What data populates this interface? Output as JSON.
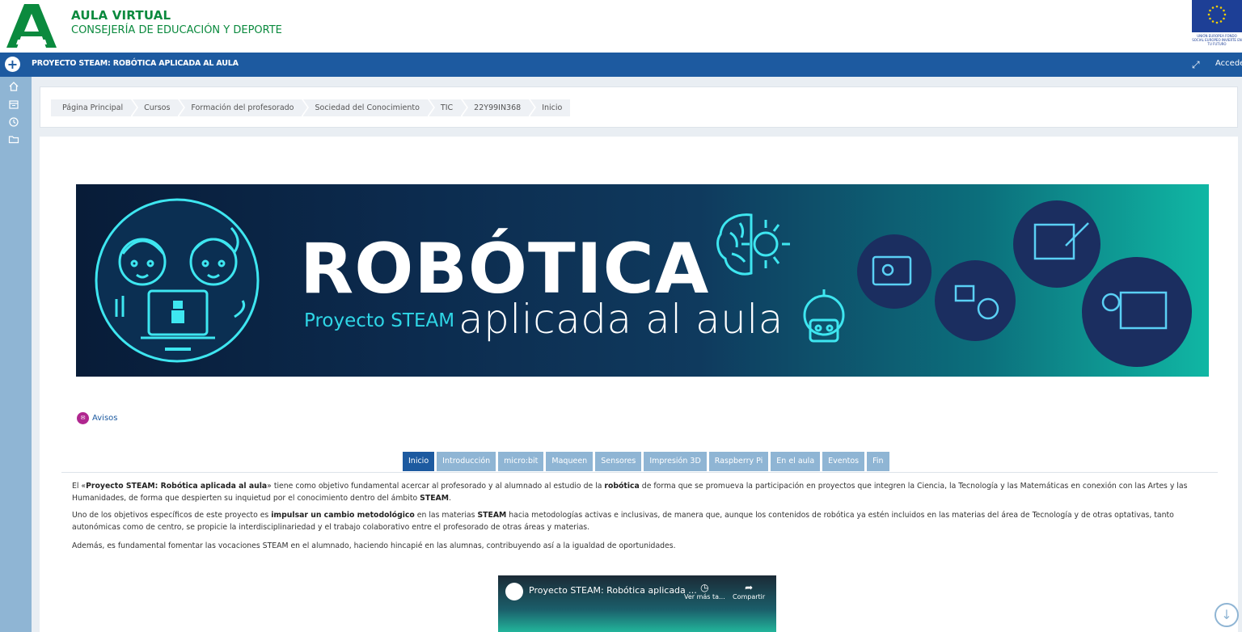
{
  "header": {
    "title": "AULA VIRTUAL",
    "subtitle": "CONSEJERÍA DE EDUCACIÓN Y DEPORTE",
    "eu_text": "UNIÓN EUROPEA FONDO SOCIAL EUROPEO INVIERTE EN TU FUTURO"
  },
  "course_bar": {
    "title": "PROYECTO STEAM: ROBÓTICA APLICADA AL AULA",
    "access_label": "Acceder",
    "colors": {
      "bar": "#1d5aa0"
    }
  },
  "sidebar": {
    "icons": [
      "home-icon",
      "calendar-icon",
      "clock-icon",
      "folder-icon"
    ]
  },
  "breadcrumb": [
    "Página Principal",
    "Cursos",
    "Formación del profesorado",
    "Sociedad del Conocimiento",
    "TIC",
    "22Y99IN368",
    "Inicio"
  ],
  "banner": {
    "title": "ROBÓTICA",
    "subtitle_small": "Proyecto STEAM",
    "subtitle_large": "aplicada al aula"
  },
  "avisos": {
    "label": "Avisos"
  },
  "tabs": [
    {
      "label": "Inicio",
      "active": true
    },
    {
      "label": "Introducción",
      "active": false
    },
    {
      "label": "micro:bit",
      "active": false
    },
    {
      "label": "Maqueen",
      "active": false
    },
    {
      "label": "Sensores",
      "active": false
    },
    {
      "label": "Impresión 3D",
      "active": false
    },
    {
      "label": "Raspberry Pi",
      "active": false
    },
    {
      "label": "En el aula",
      "active": false
    },
    {
      "label": "Eventos",
      "active": false
    },
    {
      "label": "Fin",
      "active": false
    }
  ],
  "content": {
    "p1": {
      "a": "El «",
      "b": "Proyecto STEAM: Robótica aplicada al aula",
      "c": "» tiene como objetivo fundamental acercar al profesorado y al alumnado al estudio de la ",
      "d": "robótica",
      "e": " de forma que se promueva la participación en proyectos que integren la Ciencia, la Tecnología y las Matemáticas en conexión con las Artes y las Humanidades, de forma que despierten su inquietud por el conocimiento dentro del ámbito ",
      "f": "STEAM",
      "g": "."
    },
    "p2": {
      "a": "Uno de los objetivos específicos de este proyecto es ",
      "b": "impulsar un cambio metodológico",
      "c": " en las materias ",
      "d": "STEAM",
      "e": " hacia metodologías activas e inclusivas, de manera que, aunque los contenidos de robótica ya estén incluidos en las materias del área de Tecnología y de otras optativas, tanto autonómicas como de centro, se propicie la interdisciplinariedad y el trabajo colaborativo entre el profesorado de otras áreas y materias."
    },
    "p3": "Además, es fundamental fomentar las vocaciones STEAM en el alumnado, haciendo hincapié en las alumnas, contribuyendo así a la igualdad de oportunidades."
  },
  "video": {
    "title": "Proyecto STEAM: Robótica aplicada ...",
    "watch_later": "Ver más ta...",
    "share": "Compartir"
  }
}
